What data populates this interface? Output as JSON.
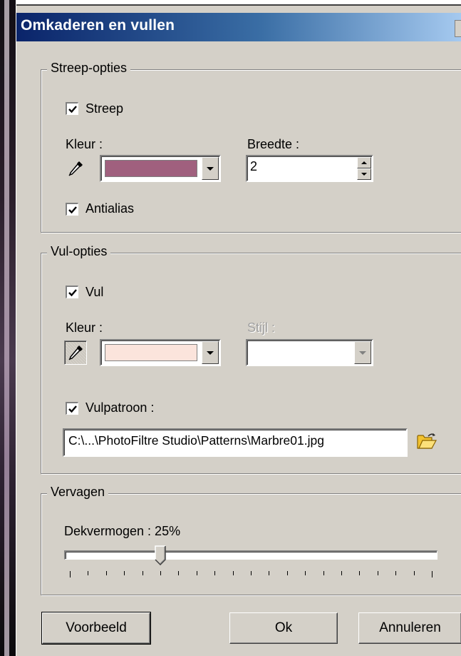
{
  "window": {
    "title": "Omkaderen en vullen"
  },
  "stroke_group": {
    "legend": "Streep-opties",
    "stroke_label": "Streep",
    "stroke_checked": true,
    "color_label": "Kleur :",
    "color_value": "#a0607e",
    "width_label": "Breedte :",
    "width_value": "2",
    "antialias_label": "Antialias",
    "antialias_checked": true
  },
  "fill_group": {
    "legend": "Vul-opties",
    "fill_label": "Vul",
    "fill_checked": true,
    "color_label": "Kleur :",
    "color_value": "#fbe4dc",
    "style_label": "Stijl :",
    "pattern_label": "Vulpatroon :",
    "pattern_checked": true,
    "pattern_path": "C:\\...\\PhotoFiltre Studio\\Patterns\\Marbre01.jpg"
  },
  "fade_group": {
    "legend": "Vervagen",
    "opacity_label": "Dekvermogen : 25%",
    "opacity_value": 25
  },
  "buttons": {
    "preview": "Voorbeeld",
    "ok": "Ok",
    "cancel": "Annuleren"
  },
  "icons": {
    "pipette": "pipette-icon",
    "folder": "open-folder-icon",
    "check": "checkmark-icon"
  }
}
